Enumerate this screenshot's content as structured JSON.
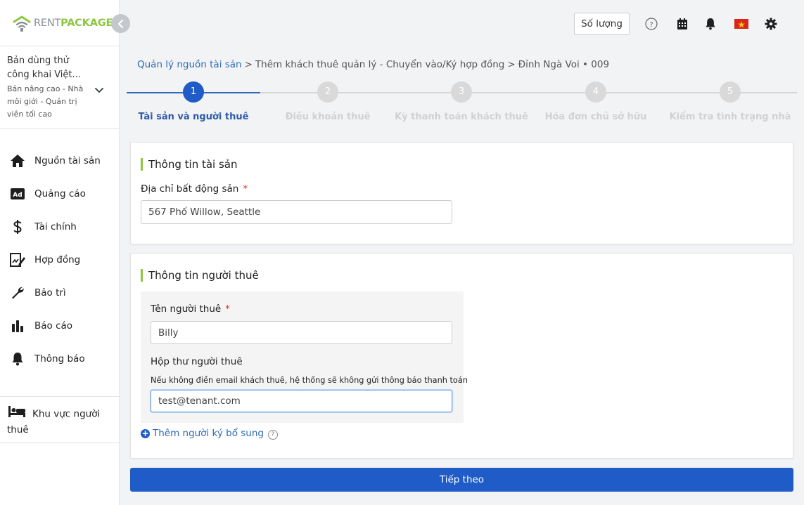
{
  "brand": {
    "rent": "RENT",
    "package": "PACKAGE"
  },
  "plan": {
    "name": "Bản dùng thử công khai Việt...",
    "description": "Bản nâng cao - Nhà môi giới - Quản trị viên tối cao"
  },
  "nav": {
    "items": [
      {
        "label": "Nguồn tài sản",
        "icon": "home-icon"
      },
      {
        "label": "Quảng cáo",
        "icon": "ad-icon"
      },
      {
        "label": "Tài chính",
        "icon": "dollar-icon"
      },
      {
        "label": "Hợp đồng",
        "icon": "contract-icon"
      },
      {
        "label": "Bảo trì",
        "icon": "wrench-icon"
      },
      {
        "label": "Báo cáo",
        "icon": "bar-chart-icon"
      },
      {
        "label": "Thông báo",
        "icon": "bell-icon"
      }
    ],
    "tenant_zone": "Khu vực người thuê"
  },
  "topbar": {
    "quantity_label": "Số lượng",
    "icons": [
      "help-icon",
      "calendar-icon",
      "bell-icon",
      "vietnam-flag-icon",
      "gear-icon"
    ]
  },
  "breadcrumb": {
    "root": "Quản lý nguồn tài sản",
    "sep": ">",
    "middle": "Thêm khách thuê quản lý - Chuyển vào/Ký hợp đồng",
    "current": "Đỉnh Ngà Voi • 009"
  },
  "steps": [
    {
      "num": "1",
      "label": "Tài sản và người thuê",
      "active": true
    },
    {
      "num": "2",
      "label": "Điều khoản thuê",
      "active": false
    },
    {
      "num": "3",
      "label": "Kỳ thanh toán khách thuê",
      "active": false
    },
    {
      "num": "4",
      "label": "Hóa đơn chủ sở hữu",
      "active": false
    },
    {
      "num": "5",
      "label": "Kiểm tra tình trạng nhà",
      "active": false
    }
  ],
  "property": {
    "title": "Thông tin tài sản",
    "address_label": "Địa chỉ bất động sản",
    "required_mark": "*",
    "address_value": "567 Phố Willow, Seattle"
  },
  "tenant": {
    "title": "Thông tin người thuê",
    "name_label": "Tên người thuê",
    "required_mark": "*",
    "name_value": "Billy",
    "email_label": "Hộp thư người thuê",
    "email_hint": "Nếu không điền email khách thuê, hệ thống sẽ không gửi thông báo thanh toán",
    "email_value": "test@tenant.com",
    "add_signer": "Thêm người ký bổ sung",
    "help_mark": "?"
  },
  "actions": {
    "next": "Tiếp theo"
  },
  "colors": {
    "primary": "#1f5cc7",
    "brand_green": "#8cc63f",
    "link": "#2e6bb8"
  }
}
